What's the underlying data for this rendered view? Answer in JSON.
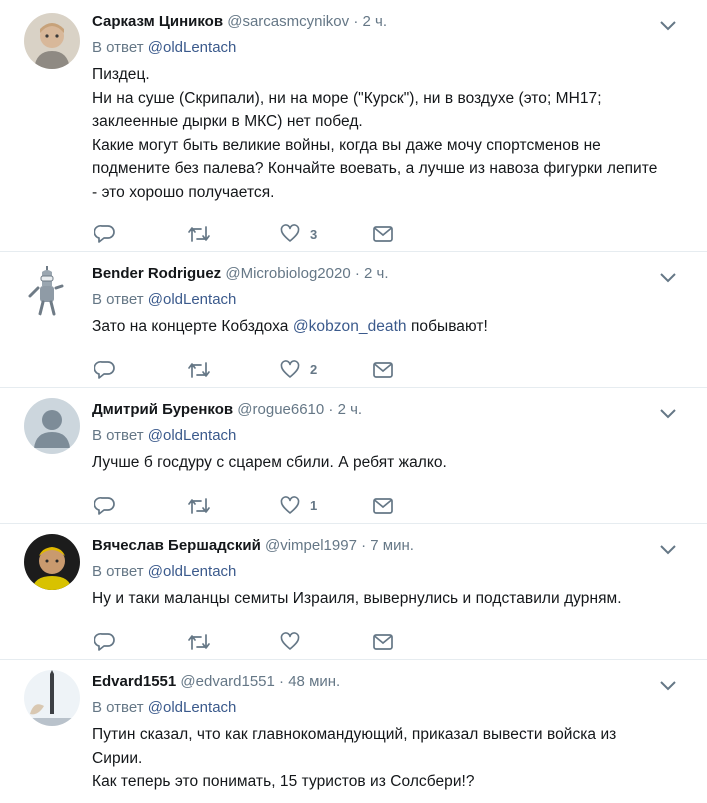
{
  "reply_prefix": "В ответ",
  "tweets": [
    {
      "name": "Сарказм Циников",
      "handle": "@sarcasmcynikov",
      "sep": "·",
      "time": "2 ч.",
      "reply_to": "@oldLentach",
      "lines": [
        "Пиздец.",
        "Ни на суше (Скрипали), ни на море (\"Курск\"), ни в воздухе (это; MH17;",
        "заклеенные дырки в МКС) нет побед.",
        "Какие могут быть великие войны, когда вы даже мочу спортсменов не",
        "подмените без палева? Кончайте воевать, а лучше из навоза фигурки лепите",
        "- это хорошо получается."
      ],
      "likes": "3"
    },
    {
      "name": "Bender Rodriguez",
      "handle": "@Microbiolog2020",
      "sep": "·",
      "time": "2 ч.",
      "reply_to": "@oldLentach",
      "text_before": "Зато на концерте Кобздоха ",
      "mention": "@kobzon_death",
      "text_after": " побывают!",
      "likes": "2"
    },
    {
      "name": "Дмитрий Буренков",
      "handle": "@rogue6610",
      "sep": "·",
      "time": "2 ч.",
      "reply_to": "@oldLentach",
      "lines": [
        "Лучше б госдуру с сцарем сбили. А ребят жалко."
      ],
      "likes": "1"
    },
    {
      "name": "Вячеслав Бершадский",
      "handle": "@vimpel1997",
      "sep": "·",
      "time": "7 мин.",
      "reply_to": "@oldLentach",
      "lines": [
        "Ну и таки маланцы семиты Израиля, вывернулись и подставили дурням."
      ],
      "likes": ""
    },
    {
      "name": "Edvard1551",
      "handle": "@edvard1551",
      "sep": "·",
      "time": "48 мин.",
      "reply_to": "@oldLentach",
      "lines": [
        "Путин сказал, что как главнокомандующий, приказал вывести войска из",
        "Сирии.",
        "Как теперь это понимать, 15 туристов из Солсбери!?"
      ],
      "likes": ""
    }
  ],
  "icons": {
    "reply": "reply-icon",
    "retweet": "retweet-icon",
    "like": "heart-icon",
    "dm": "envelope-icon",
    "caret": "chevron-down-icon"
  },
  "colors": {
    "text": "#14171a",
    "muted": "#657786",
    "link": "#3b5a8c",
    "icon": "#657786",
    "divider": "#e6ecf0"
  }
}
